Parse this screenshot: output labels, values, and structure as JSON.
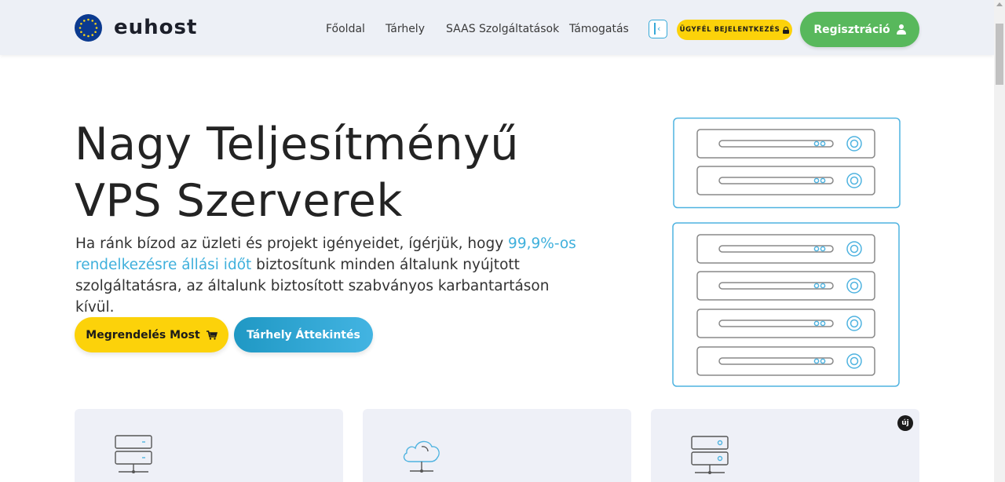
{
  "brand": {
    "name": "euhost",
    "flag_icon": "eu-flag-icon"
  },
  "nav": {
    "items": [
      {
        "label": "Főoldal"
      },
      {
        "label": "Tárhely"
      },
      {
        "label": "SAAS Szolgáltatások"
      },
      {
        "label": "Támogatás"
      }
    ],
    "collapse_icon": "sidebar-collapse-icon",
    "login_label": "ÜGYFÉL BEJELENTKEZÉS",
    "register_label": "Regisztráció"
  },
  "hero": {
    "title_line1": "Nagy Teljesítményű",
    "title_line2": "VPS Szerverek",
    "desc_part1": "Ha ránk bízod az üzleti és projekt igényeidet, ígérjük, hogy ",
    "desc_highlight": "99,9%-os rendelkezésre állási időt",
    "desc_part2": " biztosítunk minden általunk nyújtott szolgáltatásra, az általunk biztosított szabványos karbantartáson kívül.",
    "order_label": "Megrendelés Most",
    "overview_label": "Tárhely Áttekintés"
  },
  "cards": [
    {
      "icon": "server-network-icon"
    },
    {
      "icon": "cloud-network-icon"
    },
    {
      "icon": "server-rack-icon",
      "badge": "új"
    }
  ],
  "colors": {
    "accent_blue": "#3fb0dc",
    "yellow": "#fcd20a",
    "green": "#58b85c",
    "header_bg": "#edf0f6"
  }
}
